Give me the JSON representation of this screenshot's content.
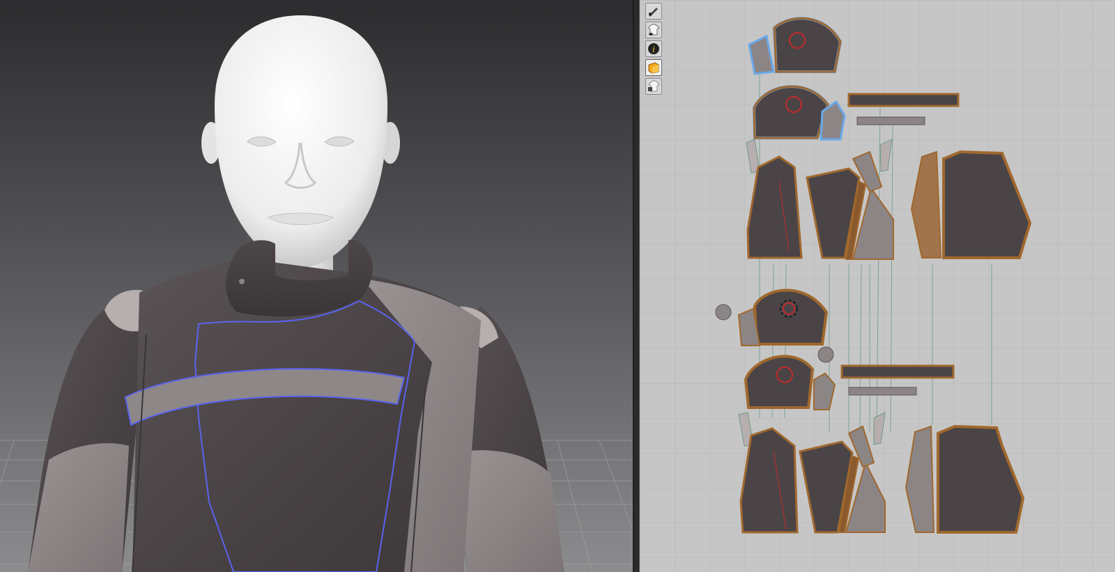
{
  "app": {
    "accent_color": "#5a63f0",
    "selection_color": "#6aa8e8",
    "fabric_dark": "#4a4446",
    "fabric_light": "#8c8586",
    "seam_brown": "#a0682e"
  },
  "viewport_3d": {
    "background_top": "#2c2c2e",
    "background_bottom": "#8a8a8c",
    "avatar": "white-mannequin",
    "garment": "jacket-with-panels"
  },
  "viewport_2d": {
    "background": "#c6c6c6",
    "toolbar": [
      {
        "icon": "edit-pattern-icon",
        "active": false
      },
      {
        "icon": "show-garment-icon",
        "active": false
      },
      {
        "icon": "info-icon",
        "active": false
      },
      {
        "icon": "texture-icon",
        "active": true
      },
      {
        "icon": "lock-garment-icon",
        "active": false
      }
    ]
  }
}
